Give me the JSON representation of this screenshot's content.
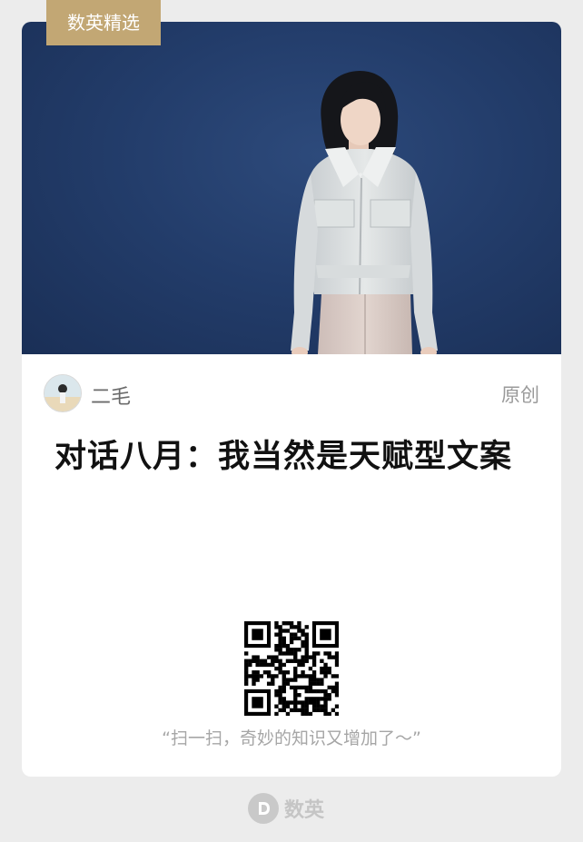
{
  "tag": {
    "label": "数英精选"
  },
  "author": {
    "name": "二毛",
    "original_label": "原创"
  },
  "article": {
    "title": "对话八月：我当然是天赋型文案"
  },
  "qr": {
    "caption": "“扫一扫，奇妙的知识又增加了～”"
  },
  "footer": {
    "brand": "数英"
  },
  "colors": {
    "background": "#ececec",
    "tag": "#c2a774",
    "hero_wall": "#233d6b",
    "title": "#111111",
    "muted": "#9a9a9a"
  },
  "icons": {
    "avatar": "profile-photo",
    "footer_logo": "digitaling-d-logo"
  }
}
